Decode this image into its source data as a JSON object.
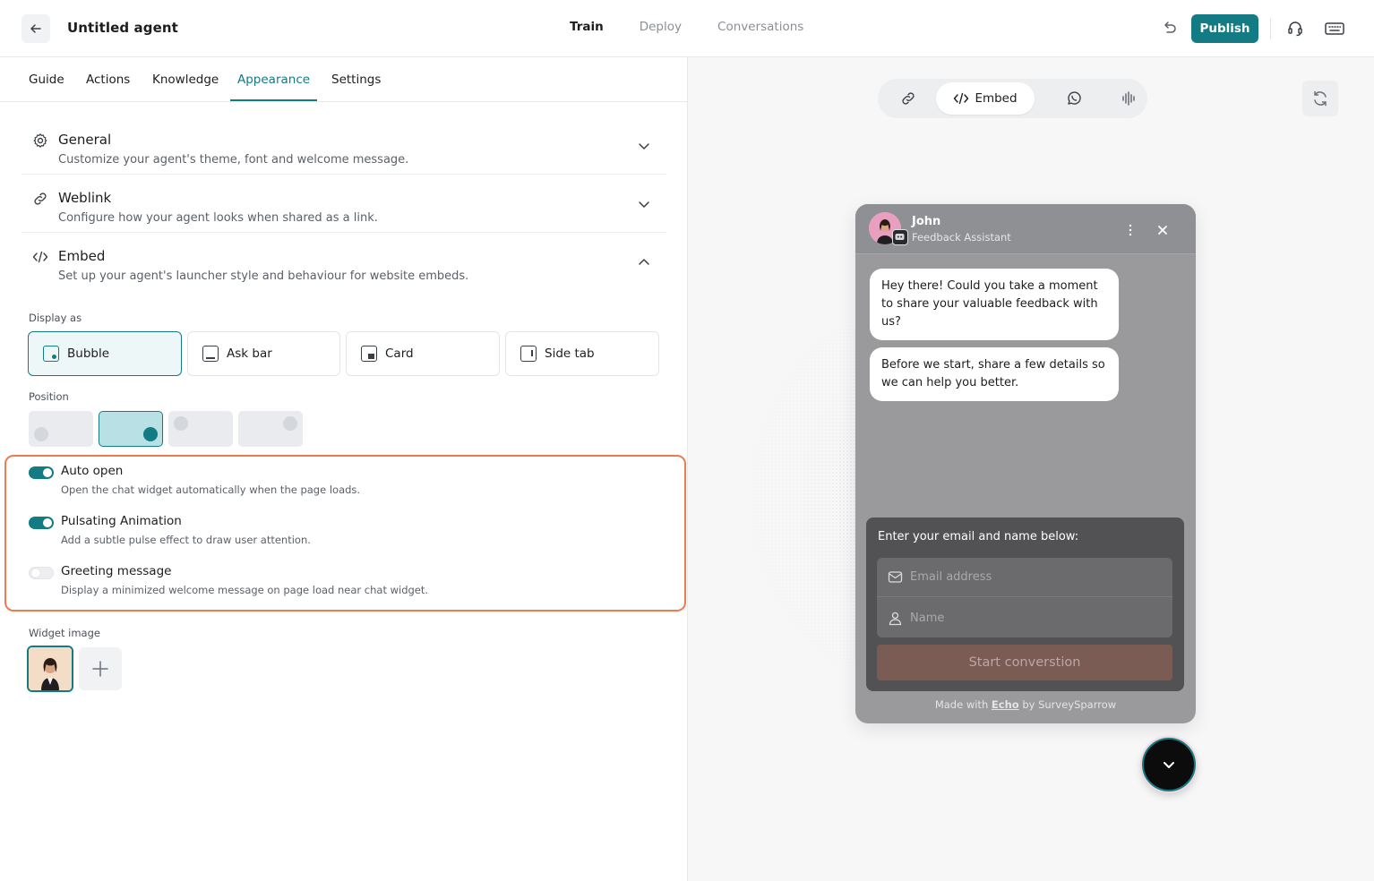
{
  "header": {
    "title": "Untitled agent",
    "tabs": [
      "Train",
      "Deploy",
      "Conversations"
    ],
    "active_tab": "Train",
    "publish_label": "Publish"
  },
  "subtabs": [
    "Guide",
    "Actions",
    "Knowledge",
    "Appearance",
    "Settings"
  ],
  "active_subtab": "Appearance",
  "sections": [
    {
      "title": "General",
      "desc": "Customize your agent's theme, font and welcome message.",
      "icon": "gear-icon",
      "expanded": false
    },
    {
      "title": "Weblink",
      "desc": "Configure how your agent looks when shared as a link.",
      "icon": "link-icon",
      "expanded": false
    },
    {
      "title": "Embed",
      "desc": "Set up your agent's launcher style and behaviour for website embeds.",
      "icon": "code-icon",
      "expanded": true
    }
  ],
  "embed": {
    "display_as_label": "Display as",
    "display_options": [
      "Bubble",
      "Ask bar",
      "Card",
      "Side tab"
    ],
    "selected_display": "Bubble",
    "position_label": "Position",
    "selected_position": "bottom-right",
    "toggles": [
      {
        "title": "Auto open",
        "desc": "Open the chat widget automatically when the page loads.",
        "on": true
      },
      {
        "title": "Pulsating Animation",
        "desc": "Add a subtle pulse effect to draw user attention.",
        "on": true
      },
      {
        "title": "Greeting message",
        "desc": "Display a minimized welcome message on page load near chat widget.",
        "on": false
      }
    ],
    "widget_image_label": "Widget image"
  },
  "preview": {
    "channels": [
      "link-icon",
      "Embed",
      "whatsapp-icon",
      "voice-icon"
    ],
    "active_channel": "Embed",
    "chat": {
      "agent_name": "John",
      "agent_role": "Feedback Assistant",
      "messages": [
        "Hey there! Could you take a moment to share your valuable feedback with us?",
        "Before we start, share a few details so we can help you better."
      ],
      "form_title": "Enter your email and name below:",
      "email_placeholder": "Email address",
      "name_placeholder": "Name",
      "start_label": "Start converstion",
      "footer_prefix": "Made with",
      "footer_brand": "Echo",
      "footer_suffix": "by SurveySparrow"
    }
  },
  "colors": {
    "accent": "#137b83",
    "highlight": "#ef7a4b"
  }
}
